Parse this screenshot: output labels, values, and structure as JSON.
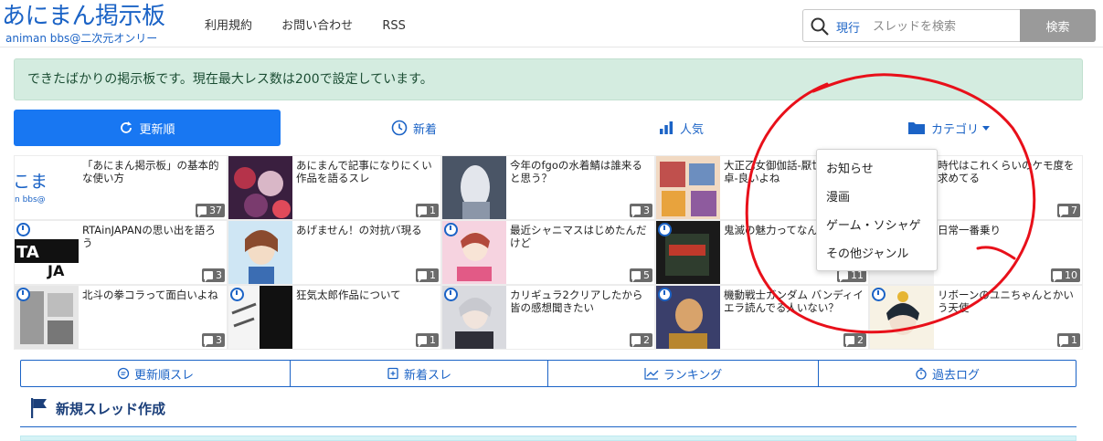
{
  "header": {
    "logo_title": "あにまん掲示板",
    "logo_sub": "animan bbs@二次元オンリー",
    "nav": [
      "利用規約",
      "お問い合わせ",
      "RSS"
    ],
    "search_scope": "現行",
    "search_placeholder": "スレッドを検索",
    "search_button": "検索"
  },
  "notice": "できたばかりの掲示板です。現在最大レス数は200で設定しています。",
  "tabs": [
    {
      "label": "更新順",
      "active": true,
      "icon": "refresh-icon"
    },
    {
      "label": "新着",
      "active": false,
      "icon": "clock-icon"
    },
    {
      "label": "人気",
      "active": false,
      "icon": "bar-chart-icon"
    },
    {
      "label": "カテゴリ",
      "active": false,
      "icon": "folder-icon"
    }
  ],
  "category_menu": [
    "お知らせ",
    "漫画",
    "ゲーム・ソシャゲ",
    "その他ジャンル"
  ],
  "threads": [
    {
      "title": "「あにまん掲示板」の基本的な使い方",
      "count": "37"
    },
    {
      "title": "あにまんで記事になりにくい作品を語るスレ",
      "count": "1"
    },
    {
      "title": "今年のfgoの水着鯖は誰来ると思う？",
      "count": "3"
    },
    {
      "title": "大正乙女御伽話-厭世家の初卓-良いよね",
      "count": "3"
    },
    {
      "title": "時代はこれくらいのケモ度を求めてる",
      "count": "7"
    },
    {
      "title": "RTAinJAPANの思い出を語ろう",
      "count": "3"
    },
    {
      "title": "あげません！の対抗バ現る",
      "count": "1"
    },
    {
      "title": "最近シャニマスはじめたんだけど",
      "count": "5"
    },
    {
      "title": "鬼滅の魅力ってなんですか",
      "count": "11"
    },
    {
      "title": "日常一番乗り",
      "count": "10"
    },
    {
      "title": "北斗の拳コラって面白いよね",
      "count": "3"
    },
    {
      "title": "狂気太郎作品について",
      "count": "1"
    },
    {
      "title": "カリギュラ2クリアしたから皆の感想聞きたい",
      "count": "2"
    },
    {
      "title": "機動戦士ガンダム バンディイエラ読んでる人いない？",
      "count": "2"
    },
    {
      "title": "リボーンのユニちゃんとかいう天使",
      "count": "1"
    }
  ],
  "subnav": [
    "更新順スレ",
    "新着スレ",
    "ランキング",
    "過去ログ"
  ],
  "new_thread": "新規スレッド作成",
  "colors": {
    "accent": "#1877f2",
    "brand": "#1b63c6",
    "annotation": "#e8101a"
  }
}
